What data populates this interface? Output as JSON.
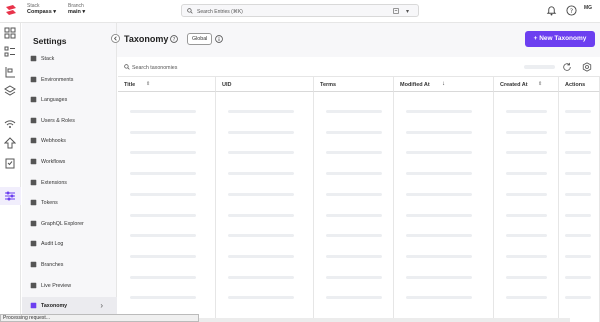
{
  "header": {
    "stack_label": "Stack",
    "stack_value": "Compass",
    "branch_label": "Branch",
    "branch_value": "main",
    "search_placeholder": "Search Entries (⌘K)",
    "avatar_initials": "MG"
  },
  "rail": {
    "icons": [
      "dashboard-icon",
      "entries-icon",
      "content-models-icon",
      "assets-icon",
      "personalize-icon",
      "deployments-icon",
      "tasks-icon",
      "settings-icon"
    ],
    "active": "settings-icon"
  },
  "sidebar": {
    "title": "Settings",
    "items": [
      {
        "label": "Stack",
        "icon": "stack-icon"
      },
      {
        "label": "Environments",
        "icon": "environments-icon"
      },
      {
        "label": "Languages",
        "icon": "languages-icon"
      },
      {
        "label": "Users & Roles",
        "icon": "users-icon"
      },
      {
        "label": "Webhooks",
        "icon": "webhooks-icon"
      },
      {
        "label": "Workflows",
        "icon": "workflows-icon"
      },
      {
        "label": "Extensions",
        "icon": "extensions-icon"
      },
      {
        "label": "Tokens",
        "icon": "tokens-icon"
      },
      {
        "label": "GraphQL Explorer",
        "icon": "graphql-icon"
      },
      {
        "label": "Audit Log",
        "icon": "audit-log-icon"
      },
      {
        "label": "Branches",
        "icon": "branches-icon"
      },
      {
        "label": "Live Preview",
        "icon": "live-preview-icon"
      },
      {
        "label": "Taxonomy",
        "icon": "taxonomy-icon",
        "active": true
      }
    ]
  },
  "main": {
    "title": "Taxonomy",
    "badge": "Global",
    "new_button": "+ New Taxonomy",
    "search_placeholder": "Search taxonomies",
    "columns": [
      "Title",
      "UID",
      "Terms",
      "Modified At",
      "Created At",
      "Actions"
    ],
    "loading": true
  },
  "status_bar": "Processing request...",
  "colors": {
    "accent": "#6c3ff0",
    "active_bg": "#f1eefc",
    "skeleton": "#eceef1"
  }
}
